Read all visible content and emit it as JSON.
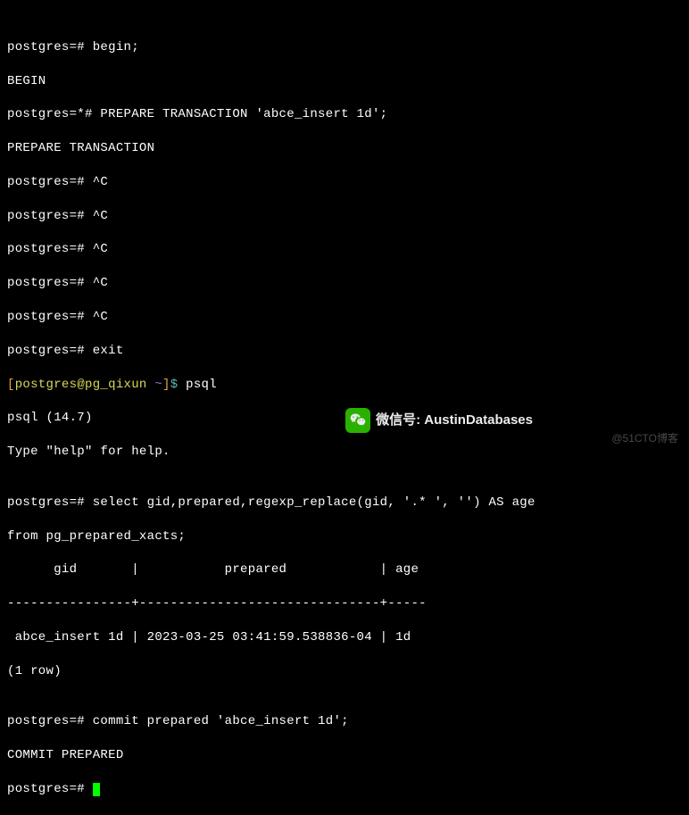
{
  "lines": {
    "l0": "",
    "l1": "postgres=# begin;",
    "l2": "BEGIN",
    "l3": "postgres=*# PREPARE TRANSACTION 'abce_insert 1d';",
    "l4": "PREPARE TRANSACTION",
    "l5": "postgres=# ^C",
    "l6": "postgres=# ^C",
    "l7": "postgres=# ^C",
    "l8": "postgres=# ^C",
    "l9": "postgres=# ^C",
    "l10": "postgres=# exit",
    "l11_user": "[postgres@pg_qixun ",
    "l11_tilde": "~",
    "l11_rest": "]$ psql",
    "l12": "psql (14.7)",
    "l13": "Type \"help\" for help.",
    "l14": "",
    "l15": "postgres=# select gid,prepared,regexp_replace(gid, '.* ', '') AS age",
    "l16": "from pg_prepared_xacts;",
    "l17": "      gid       |           prepared            | age ",
    "l18": "----------------+-------------------------------+-----",
    "l19": " abce_insert 1d | 2023-03-25 03:41:59.538836-04 | 1d",
    "l20": "(1 row)",
    "l21": "",
    "l22": "postgres=# commit prepared 'abce_insert 1d';",
    "l23": "COMMIT PREPARED",
    "l24": "postgres=# "
  },
  "watermark": {
    "label": "微信号: AustinDatabases",
    "cto": "@51CTO博客"
  }
}
